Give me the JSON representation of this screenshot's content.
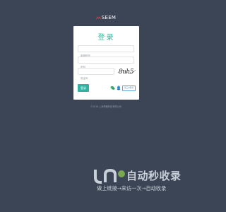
{
  "brand": {
    "name": "SEEM"
  },
  "login": {
    "title": "登录",
    "username_placeholder": "邮箱账号",
    "password_placeholder": "密码",
    "captcha_placeholder": "验证码",
    "captcha_text": "8uh5",
    "submit_label": "登录",
    "third_party_label": "第三方登录"
  },
  "footer": {
    "text": "©2016 上海思眠科技有限公司"
  },
  "watermark": {
    "title": "自动秒收录",
    "subtitle": "做上链接→来访一次→自动收录"
  },
  "colors": {
    "background": "#3b4555",
    "accent": "#2fb89a",
    "button": "#2fb3a2"
  }
}
